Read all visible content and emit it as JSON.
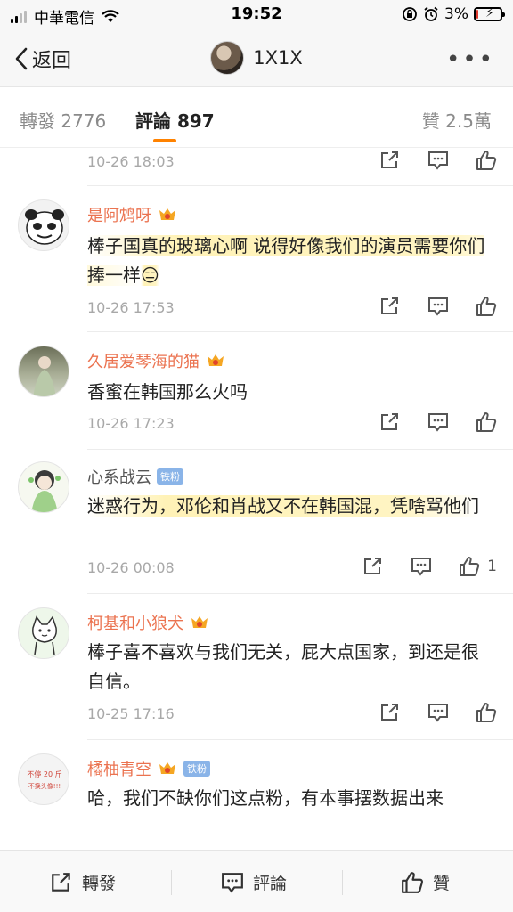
{
  "status": {
    "carrier": "中華電信",
    "time": "19:52",
    "battery": "3%"
  },
  "nav": {
    "back_label": "返回",
    "title": "1X1X"
  },
  "tabs": {
    "repost": "轉發 2776",
    "comment": "評論 897",
    "like": "贊 2.5萬"
  },
  "comments": [
    {
      "time": "10-26 18:03"
    },
    {
      "username": "是阿鸩呀",
      "text": "棒子国真的玻璃心啊 说得好像我们的演员需要你们捧一样",
      "emoji": "😑",
      "time": "10-26 17:53"
    },
    {
      "username": "久居爱琴海的猫",
      "text": "香蜜在韩国那么火吗",
      "time": "10-26 17:23"
    },
    {
      "username": "心系战云",
      "badge": "铁粉",
      "text": "迷惑行为，邓伦和肖战又不在韩国混，凭啥骂他们",
      "time": "10-26 00:08",
      "likes": "1"
    },
    {
      "username": "柯基和小狼犬",
      "text": "棒子喜不喜欢与我们无关，屁大点国家，到还是很自信。",
      "time": "10-25 17:16"
    },
    {
      "username": "橘柚青空",
      "badge": "铁粉",
      "text": "哈，我们不缺你们这点粉，有本事摆数据出来",
      "avatar_text": [
        "不停 20 斤",
        "不换头像!!!"
      ]
    }
  ],
  "bottom": {
    "repost": "轉發",
    "comment": "評論",
    "like": "贊"
  },
  "colors": {
    "accent": "#ff8200",
    "username": "#eb7350",
    "badge": "#8ab4e8"
  }
}
